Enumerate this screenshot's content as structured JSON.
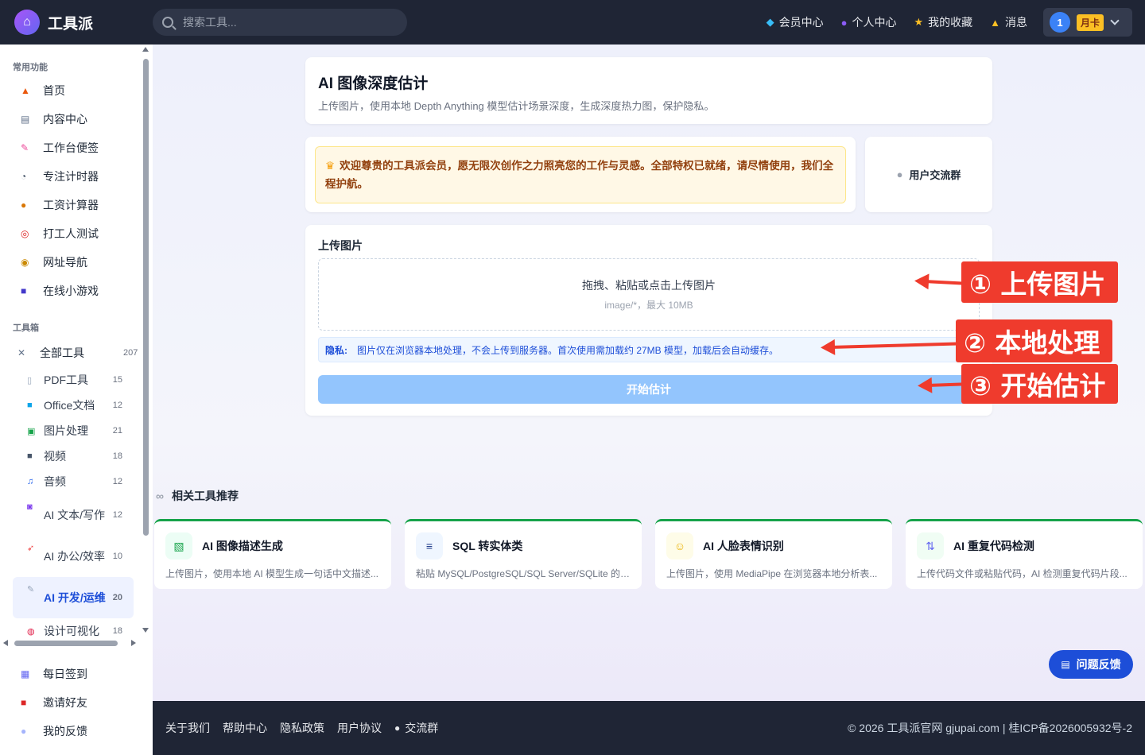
{
  "header": {
    "logo_text": "工具派",
    "search_placeholder": "搜索工具...",
    "nav": [
      {
        "label": "会员中心",
        "icon": "diamond-icon"
      },
      {
        "label": "个人中心",
        "icon": "person-icon"
      },
      {
        "label": "我的收藏",
        "icon": "star-icon"
      },
      {
        "label": "消息",
        "icon": "bell-icon"
      }
    ],
    "user": {
      "avatar_text": "1",
      "badge": "月卡"
    }
  },
  "sidebar": {
    "section_common": "常用功能",
    "common_items": [
      {
        "label": "首页",
        "icon": "home-icon"
      },
      {
        "label": "内容中心",
        "icon": "newspaper-icon"
      },
      {
        "label": "工作台便签",
        "icon": "memo-icon"
      },
      {
        "label": "专注计时器",
        "icon": "stopwatch-icon"
      },
      {
        "label": "工资计算器",
        "icon": "moneybag-icon"
      },
      {
        "label": "打工人测试",
        "icon": "target-icon"
      },
      {
        "label": "网址导航",
        "icon": "compass-icon"
      },
      {
        "label": "在线小游戏",
        "icon": "gamepad-icon"
      }
    ],
    "section_tools": "工具箱",
    "all_tools": {
      "label": "全部工具",
      "count": "207"
    },
    "categories": [
      {
        "label": "PDF工具",
        "count": "15"
      },
      {
        "label": "Office文档",
        "count": "12"
      },
      {
        "label": "图片处理",
        "count": "21"
      },
      {
        "label": "视频",
        "count": "18"
      },
      {
        "label": "音频",
        "count": "12"
      },
      {
        "label": "AI 文本/写作",
        "count": "12"
      },
      {
        "label": "AI 办公/效率",
        "count": "10"
      },
      {
        "label": "AI 开发/运维",
        "count": "20"
      },
      {
        "label": "设计可视化",
        "count": "18"
      }
    ],
    "bottom_items": [
      {
        "label": "每日签到",
        "icon": "calendar-icon"
      },
      {
        "label": "邀请好友",
        "icon": "gift-icon"
      },
      {
        "label": "我的反馈",
        "icon": "speech-bubble-icon"
      }
    ]
  },
  "main": {
    "title": "AI 图像深度估计",
    "subtitle": "上传图片，使用本地 Depth Anything 模型估计场景深度，生成深度热力图，保护隐私。",
    "welcome": "欢迎尊贵的工具派会员，愿无限次创作之力照亮您的工作与灵感。全部特权已就绪，请尽情使用，我们全程护航。",
    "group_label": "用户交流群",
    "upload_label": "上传图片",
    "dropzone_main": "拖拽、粘贴或点击上传图片",
    "dropzone_hint": "image/*，最大 10MB",
    "privacy_label": "隐私:",
    "privacy_text": "图片仅在浏览器本地处理，不会上传到服务器。首次使用需加载约 27MB 模型，加载后会自动缓存。",
    "start_button": "开始估计"
  },
  "annotations": [
    "① 上传图片",
    "② 本地处理",
    "③ 开始估计"
  ],
  "related": {
    "heading": "相关工具推荐",
    "cards": [
      {
        "title": "AI 图像描述生成",
        "desc": "上传图片，使用本地 AI 模型生成一句话中文描述...",
        "icon": "image-caption-icon"
      },
      {
        "title": "SQL 转实体类",
        "desc": "粘贴 MySQL/PostgreSQL/SQL Server/SQLite 的 CR...",
        "icon": "database-icon"
      },
      {
        "title": "AI 人脸表情识别",
        "desc": "上传图片，使用 MediaPipe 在浏览器本地分析表...",
        "icon": "smiley-icon"
      },
      {
        "title": "AI 重复代码检测",
        "desc": "上传代码文件或粘贴代码，AI 检测重复代码片段...",
        "icon": "code-compare-icon"
      }
    ]
  },
  "feedback_button": "问题反馈",
  "footer": {
    "links": [
      "关于我们",
      "帮助中心",
      "隐私政策",
      "用户协议"
    ],
    "group_link": "交流群",
    "copyright": "© 2026 工具派官网 gjupai.com | 桂ICP备2026005932号-2"
  },
  "colors": {
    "accent": "#1d4ed8",
    "annotation": "#ef3b2d",
    "topbar": "#1f2535"
  }
}
